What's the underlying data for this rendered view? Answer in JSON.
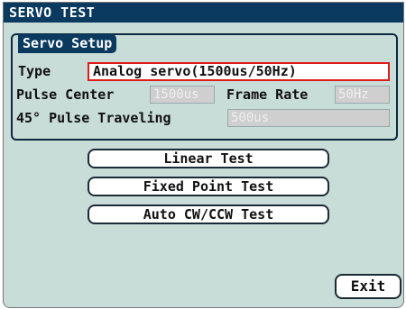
{
  "window": {
    "title": "SERVO TEST"
  },
  "servo_setup": {
    "group_title": "Servo Setup",
    "type_label": "Type",
    "type_value": "Analog servo(1500us/50Hz)",
    "pulse_center_label": "Pulse Center",
    "pulse_center_value": "1500us",
    "frame_rate_label": "Frame Rate",
    "frame_rate_value": "50Hz",
    "pulse_traveling_label": "45° Pulse Traveling",
    "pulse_traveling_value": "500us"
  },
  "tests": {
    "linear": "Linear Test",
    "fixed_point": "Fixed Point Test",
    "auto_cw_ccw": "Auto CW/CCW Test"
  },
  "exit_label": "Exit",
  "colors": {
    "title_bar": "#0b3a60",
    "screen_bg": "#c8dcd8",
    "selected_border": "#e01b1b",
    "disabled_field": "#cfcfcf"
  }
}
